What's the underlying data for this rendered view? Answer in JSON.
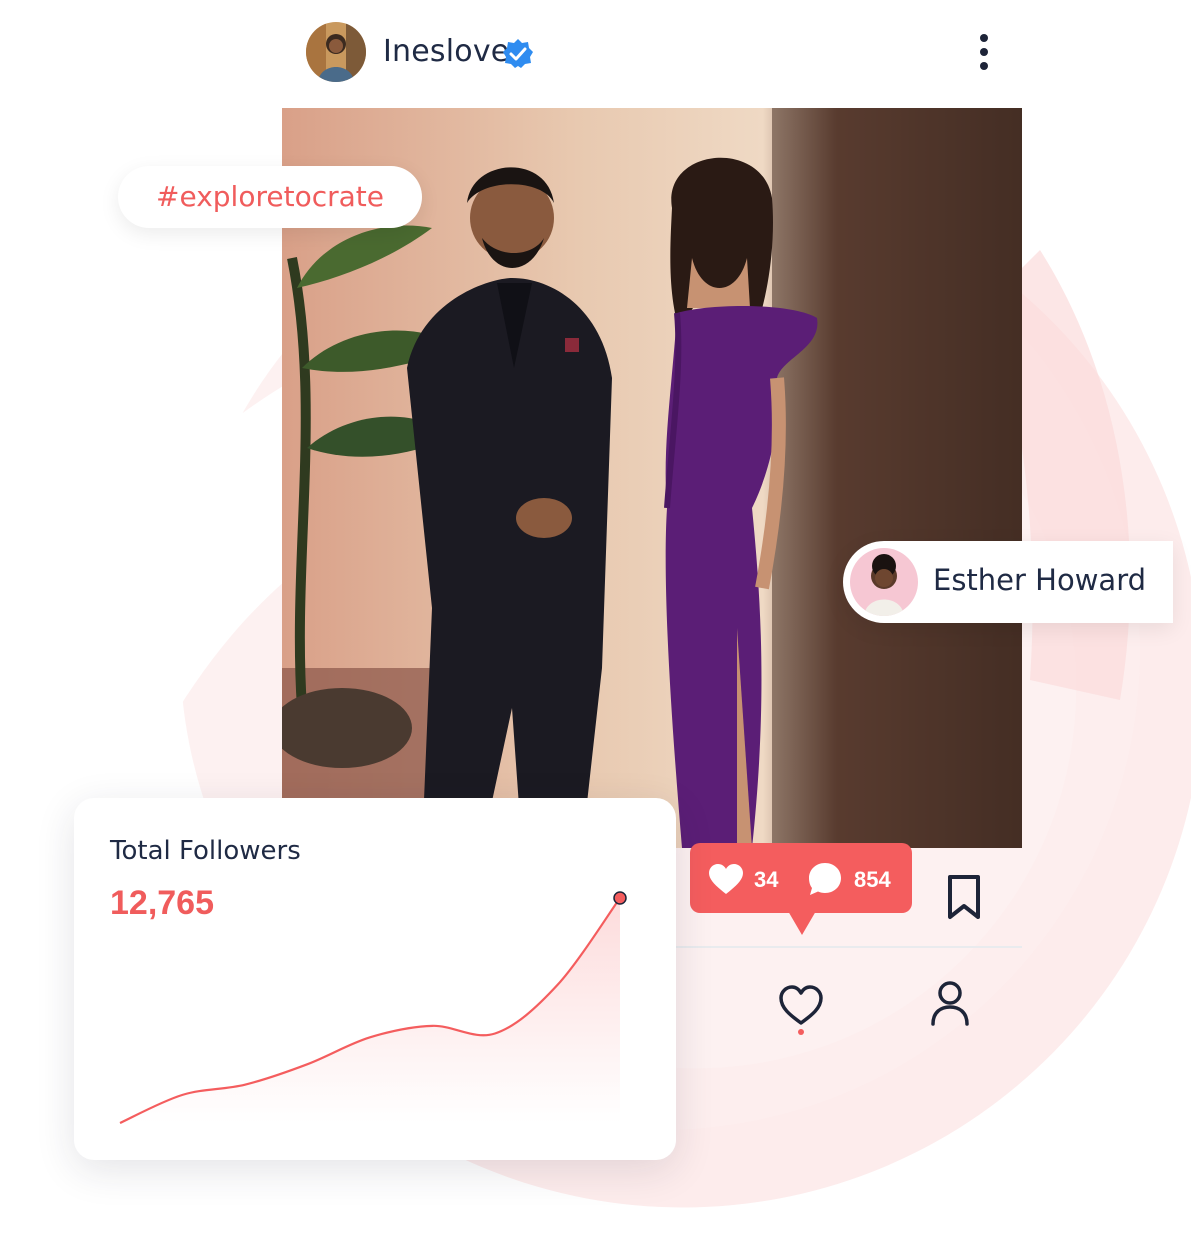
{
  "post": {
    "username": "Ineslove",
    "verified_icon": "verified-badge-icon",
    "more_icon": "more-vertical-icon",
    "hashtag": "#exploretocrate",
    "tagged_person": "Esther Howard"
  },
  "actions": {
    "likes": "34",
    "comments": "854"
  },
  "followers_card": {
    "title": "Total Followers",
    "value": "12,765"
  },
  "chart_data": {
    "type": "area",
    "title": "",
    "xlabel": "",
    "ylabel": "",
    "x": [
      0,
      1,
      2,
      3,
      4,
      5,
      6,
      7,
      8
    ],
    "values": [
      0,
      22,
      30,
      46,
      67,
      76,
      70,
      108,
      176
    ],
    "grid": false
  },
  "colors": {
    "accent": "#f45d5e",
    "text": "#1f2a44",
    "background_shape": "#fdeaea"
  }
}
